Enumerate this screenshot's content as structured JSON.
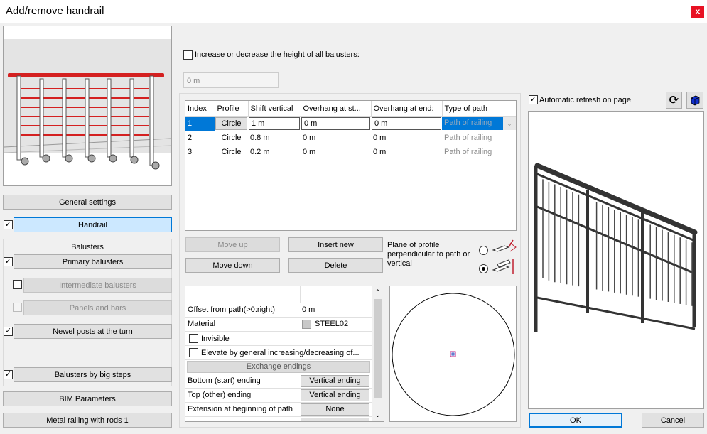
{
  "window": {
    "title": "Add/remove handrail",
    "close_glyph": "x"
  },
  "left": {
    "general_settings": "General settings",
    "handrail": "Handrail",
    "balusters_heading": "Balusters",
    "primary_balusters": "Primary balusters",
    "intermediate_balusters": "Intermediate balusters",
    "panels_and_bars": "Panels and bars",
    "newel_posts": "Newel posts at the turn",
    "balusters_big_steps": "Balusters by big steps",
    "bim_parameters": "BIM Parameters",
    "metal_railing": "Metal railing with rods 1"
  },
  "height_adjust": {
    "label": "Increase or decrease the height of all balusters:",
    "value": "0 m"
  },
  "table": {
    "headers": [
      "Index",
      "Profile",
      "Shift vertical",
      "Overhang at st...",
      "Overhang at end:",
      "Type of path"
    ],
    "rows": [
      {
        "index": "1",
        "profile": "Circle",
        "shift": "1 m",
        "over_start": "0 m",
        "over_end": "0 m",
        "path": "Path of railing"
      },
      {
        "index": "2",
        "profile": "Circle",
        "shift": "0.8 m",
        "over_start": "0 m",
        "over_end": "0 m",
        "path": "Path of railing"
      },
      {
        "index": "3",
        "profile": "Circle",
        "shift": "0.2 m",
        "over_start": "0 m",
        "over_end": "0 m",
        "path": "Path of railing"
      }
    ]
  },
  "row_buttons": {
    "move_up": "Move up",
    "move_down": "Move down",
    "insert_new": "Insert new",
    "delete": "Delete"
  },
  "plane": {
    "label": "Plane of profile perpendicular to path or vertical"
  },
  "props": {
    "offset_label": "Offset from path(>0:right)",
    "offset_value": "0 m",
    "material_label": "Material",
    "material_value": "STEEL02",
    "invisible_label": "Invisible",
    "elevate_label": "Elevate by general increasing/decreasing of...",
    "exchange_endings": "Exchange endings",
    "bottom_label": "Bottom (start) ending",
    "bottom_value": "Vertical ending",
    "top_label": "Top (other) ending",
    "top_value": "Vertical ending",
    "extension_label": "Extension at beginning of path",
    "extension_value": "None"
  },
  "preview": {
    "auto_refresh": "Automatic refresh on page"
  },
  "footer": {
    "ok": "OK",
    "cancel": "Cancel"
  },
  "colors": {
    "accent": "#0078d7",
    "handrail_red": "#d42020",
    "close_red": "#e81123"
  }
}
